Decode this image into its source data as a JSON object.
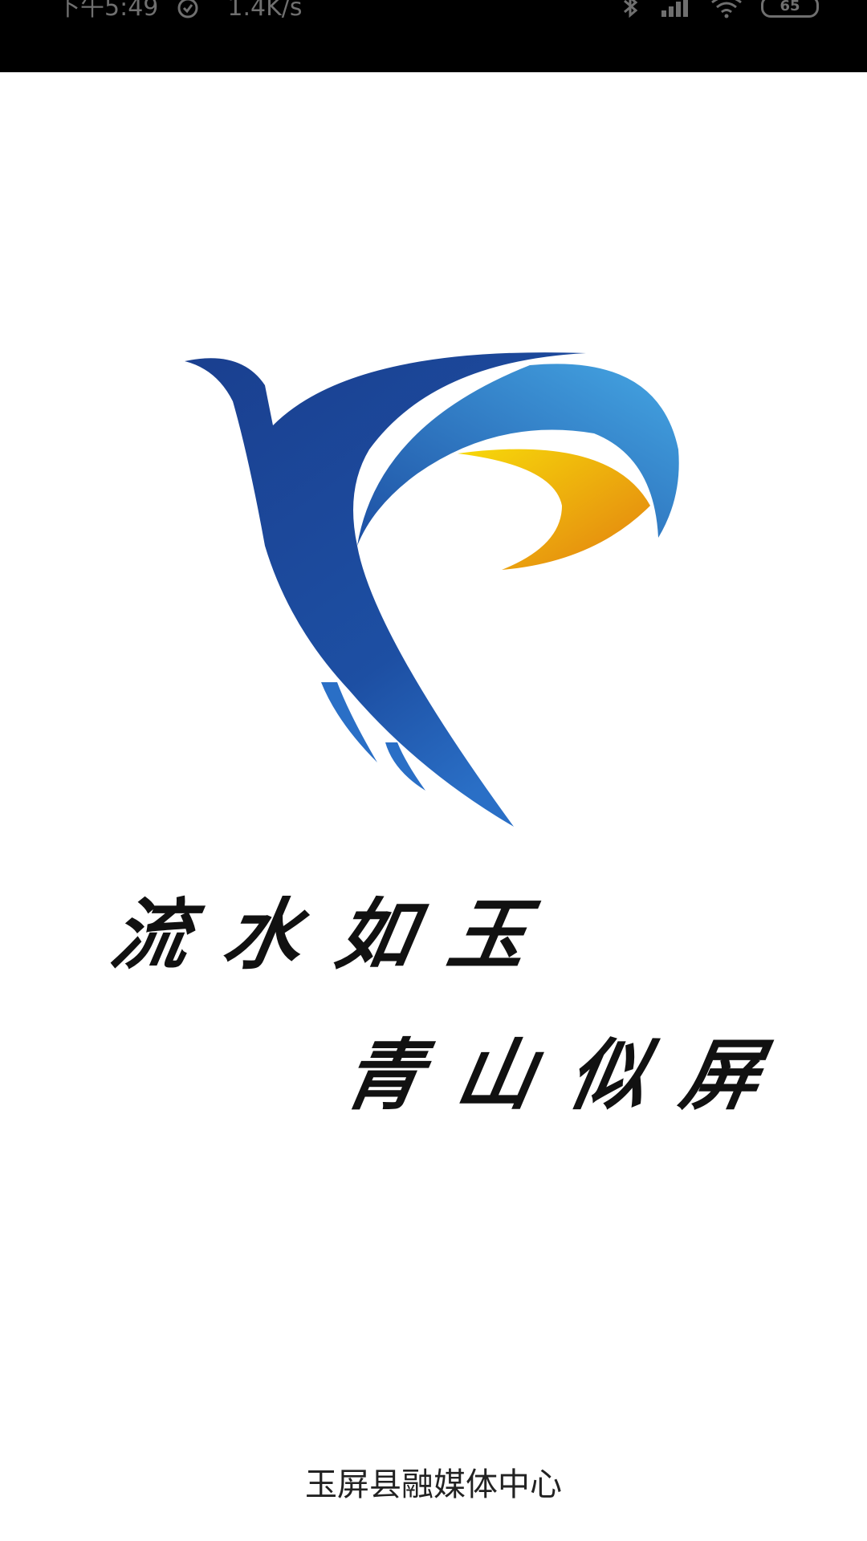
{
  "status_bar": {
    "time": "下午5:49",
    "network_speed": "1.4K/s",
    "battery_level": "65",
    "icons": [
      "alarm-icon",
      "bluetooth-icon",
      "signal-icon",
      "wifi-icon",
      "battery-icon"
    ]
  },
  "splash": {
    "slogan_line_1": "流水如玉",
    "slogan_line_2": "青山似屏",
    "organization": "玉屏县融媒体中心"
  },
  "colors": {
    "logo_blue_dark": "#1a3f8f",
    "logo_blue_light": "#3b8fd9",
    "logo_yellow": "#f5d10a",
    "logo_orange": "#e8850f",
    "status_bar_bg": "#000000",
    "page_bg": "#ffffff"
  }
}
